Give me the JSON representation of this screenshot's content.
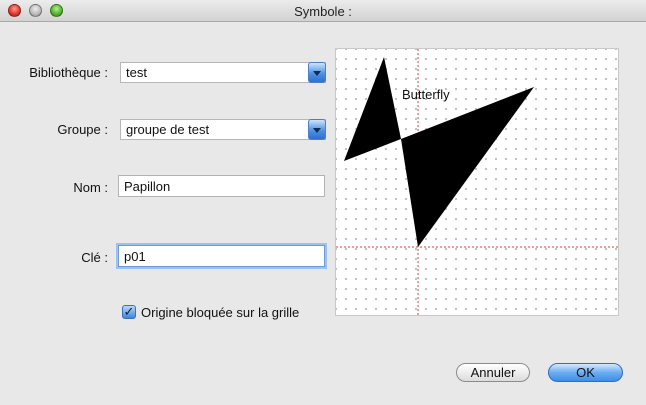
{
  "window": {
    "title": "Symbole :"
  },
  "form": {
    "library": {
      "label": "Bibliothèque :",
      "value": "test"
    },
    "group": {
      "label": "Groupe :",
      "value": "groupe de test"
    },
    "name": {
      "label": "Nom :",
      "value": "Papillon"
    },
    "key": {
      "label": "Clé :",
      "value": "p01"
    },
    "lock_origin": {
      "label": "Origine bloquée sur la grille",
      "checked": true
    }
  },
  "preview": {
    "caption": "Butterfly",
    "grid_color": "#b5b5b5",
    "crosshair_color": "#d04040",
    "shape_color": "#000000"
  },
  "buttons": {
    "cancel_label": "Annuler",
    "ok_label": "OK"
  },
  "colors": {
    "accent": "#4d92e2",
    "window_bg": "#e8e8e8"
  }
}
